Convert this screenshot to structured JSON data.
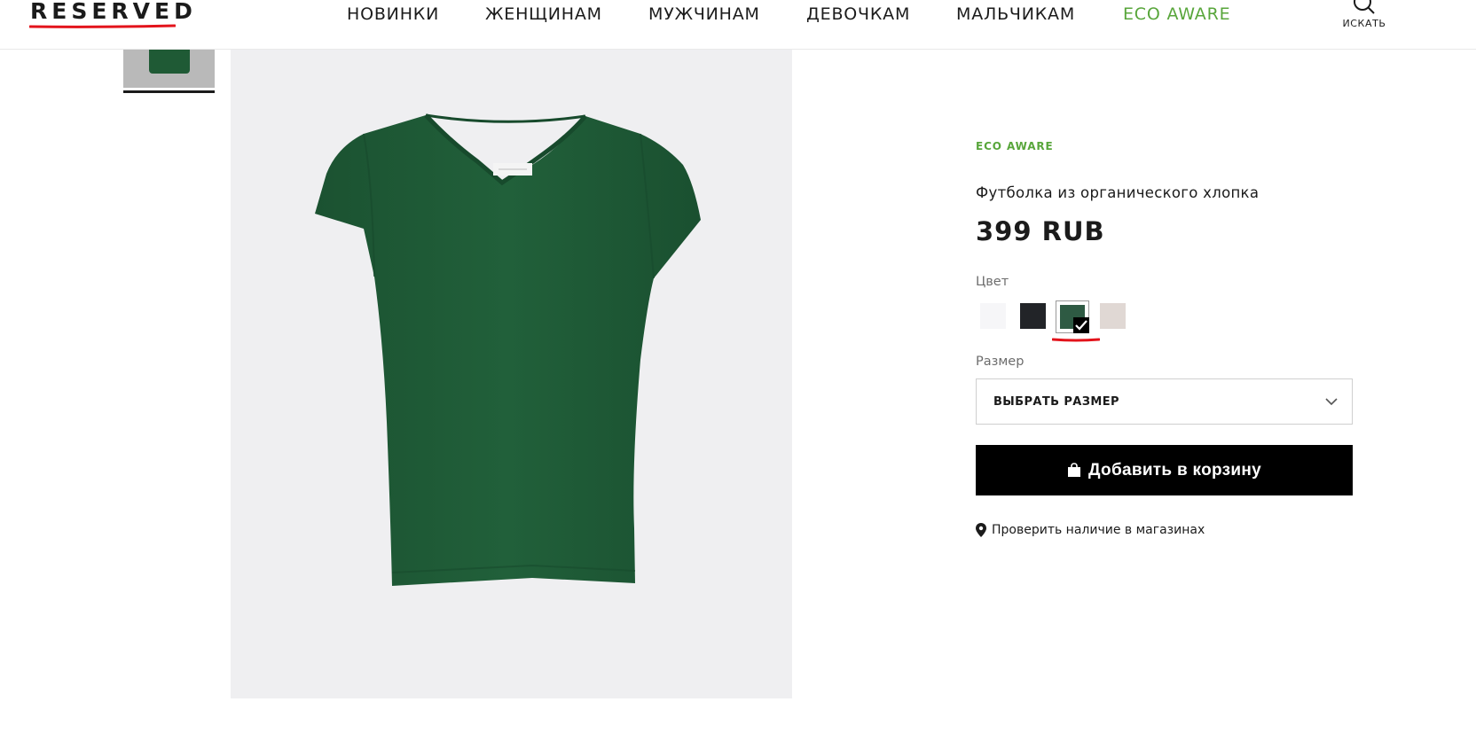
{
  "header": {
    "logo": "RESERVED",
    "nav": [
      {
        "label": "НОВИНКИ"
      },
      {
        "label": "ЖЕНЩИНАМ"
      },
      {
        "label": "МУЖЧИНАМ"
      },
      {
        "label": "ДЕВОЧКАМ"
      },
      {
        "label": "МАЛЬЧИКАМ"
      },
      {
        "label": "ECO AWARE"
      }
    ],
    "search_label": "ИСКАТЬ",
    "search_icon": "search-icon"
  },
  "product": {
    "eco_label": "ECO AWARE",
    "name": "Футболка из органического хлопка",
    "price": "399 RUB",
    "color_label": "Цвет",
    "colors": [
      {
        "name": "white",
        "hex": "#f6f6f8",
        "selected": false
      },
      {
        "name": "black",
        "hex": "#222428",
        "selected": false
      },
      {
        "name": "green",
        "hex": "#2e5a43",
        "selected": true
      },
      {
        "name": "beige",
        "hex": "#e0d8d4",
        "selected": false
      }
    ],
    "size_label": "Размер",
    "size_placeholder": "ВЫБРАТЬ РАЗМЕР",
    "add_to_cart": "Добавить в корзину",
    "store_check": "Проверить наличие в магазинах"
  },
  "theme": {
    "accent_green": "#58a63b",
    "annotation_red": "#e3131b",
    "shirt_green": "#1f5a35",
    "image_bg": "#efeff1"
  }
}
